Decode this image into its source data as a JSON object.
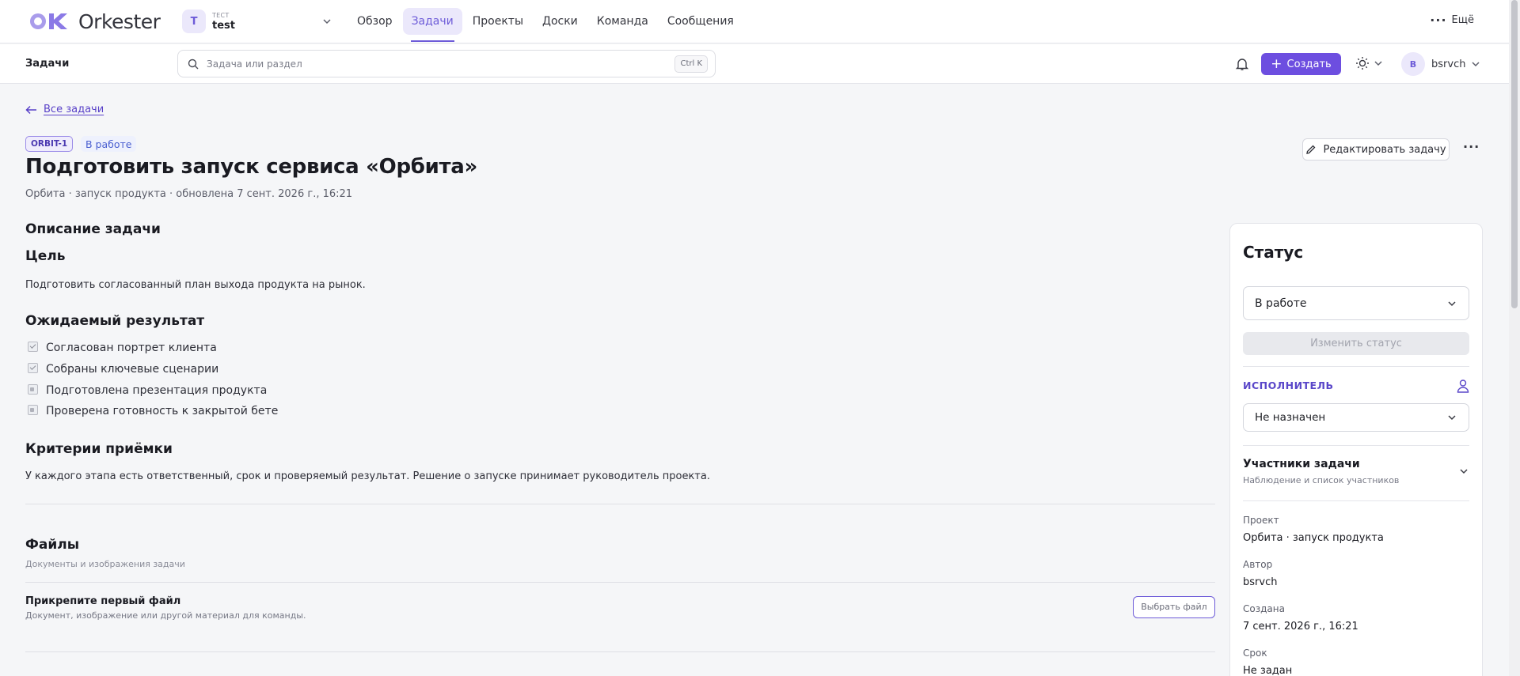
{
  "app": {
    "name": "Orkester"
  },
  "workspace": {
    "label_top": "ТЕСТ",
    "name": "test",
    "avatar": "T"
  },
  "nav": {
    "items": [
      {
        "label": "Обзор"
      },
      {
        "label": "Задачи",
        "active": true
      },
      {
        "label": "Проекты"
      },
      {
        "label": "Доски"
      },
      {
        "label": "Команда"
      },
      {
        "label": "Сообщения"
      }
    ],
    "more_label": "Ещё"
  },
  "subbar": {
    "title": "Задачи",
    "search_placeholder": "Задача или раздел",
    "shortcut": "Ctrl K",
    "create_label": "Создать",
    "user": {
      "avatar": "B",
      "name": "bsrvch"
    }
  },
  "task": {
    "back_label": "Все задачи",
    "id": "ORBIT-1",
    "status_tag": "В работе",
    "edit_label": "Редактировать задачу",
    "title": "Подготовить запуск сервиса «Орбита»",
    "meta": "Орбита · запуск продукта · обновлена 7 сент. 2026 г., 16:21",
    "description_heading": "Описание задачи",
    "goal_heading": "Цель",
    "goal_text": "Подготовить согласованный план выхода продукта на рынок.",
    "result_heading": "Ожидаемый результат",
    "checklist": [
      {
        "label": "Согласован портрет клиента",
        "checked": true
      },
      {
        "label": "Собраны ключевые сценарии",
        "checked": true
      },
      {
        "label": "Подготовлена презентация продукта",
        "checked": false
      },
      {
        "label": "Проверена готовность к закрытой бете",
        "checked": false
      }
    ],
    "criteria_heading": "Критерии приёмки",
    "criteria_text": "У каждого этапа есть ответственный, срок и проверяемый результат. Решение о запуске принимает руководитель проекта.",
    "files": {
      "heading": "Файлы",
      "subtitle": "Документы и изображения задачи",
      "empty_title": "Прикрепите первый файл",
      "empty_subtitle": "Документ, изображение или другой материал для команды.",
      "pick_label": "Выбрать файл"
    }
  },
  "panel": {
    "title": "Статус",
    "status_value": "В работе",
    "change_label": "Изменить статус",
    "assignee_heading": "ИСПОЛНИТЕЛЬ",
    "assignee_value": "Не назначен",
    "participants_heading": "Участники задачи",
    "participants_subtitle": "Наблюдение и список участников",
    "fields": [
      {
        "label": "Проект",
        "value": "Орбита · запуск продукта"
      },
      {
        "label": "Автор",
        "value": "bsrvch"
      },
      {
        "label": "Создана",
        "value": "7 сент. 2026 г., 16:21"
      },
      {
        "label": "Срок",
        "value": "Не задан"
      }
    ]
  },
  "colors": {
    "accent": "#6d4ee0",
    "accent_soft": "#ebe8fb",
    "background": "#f5f6f8"
  }
}
